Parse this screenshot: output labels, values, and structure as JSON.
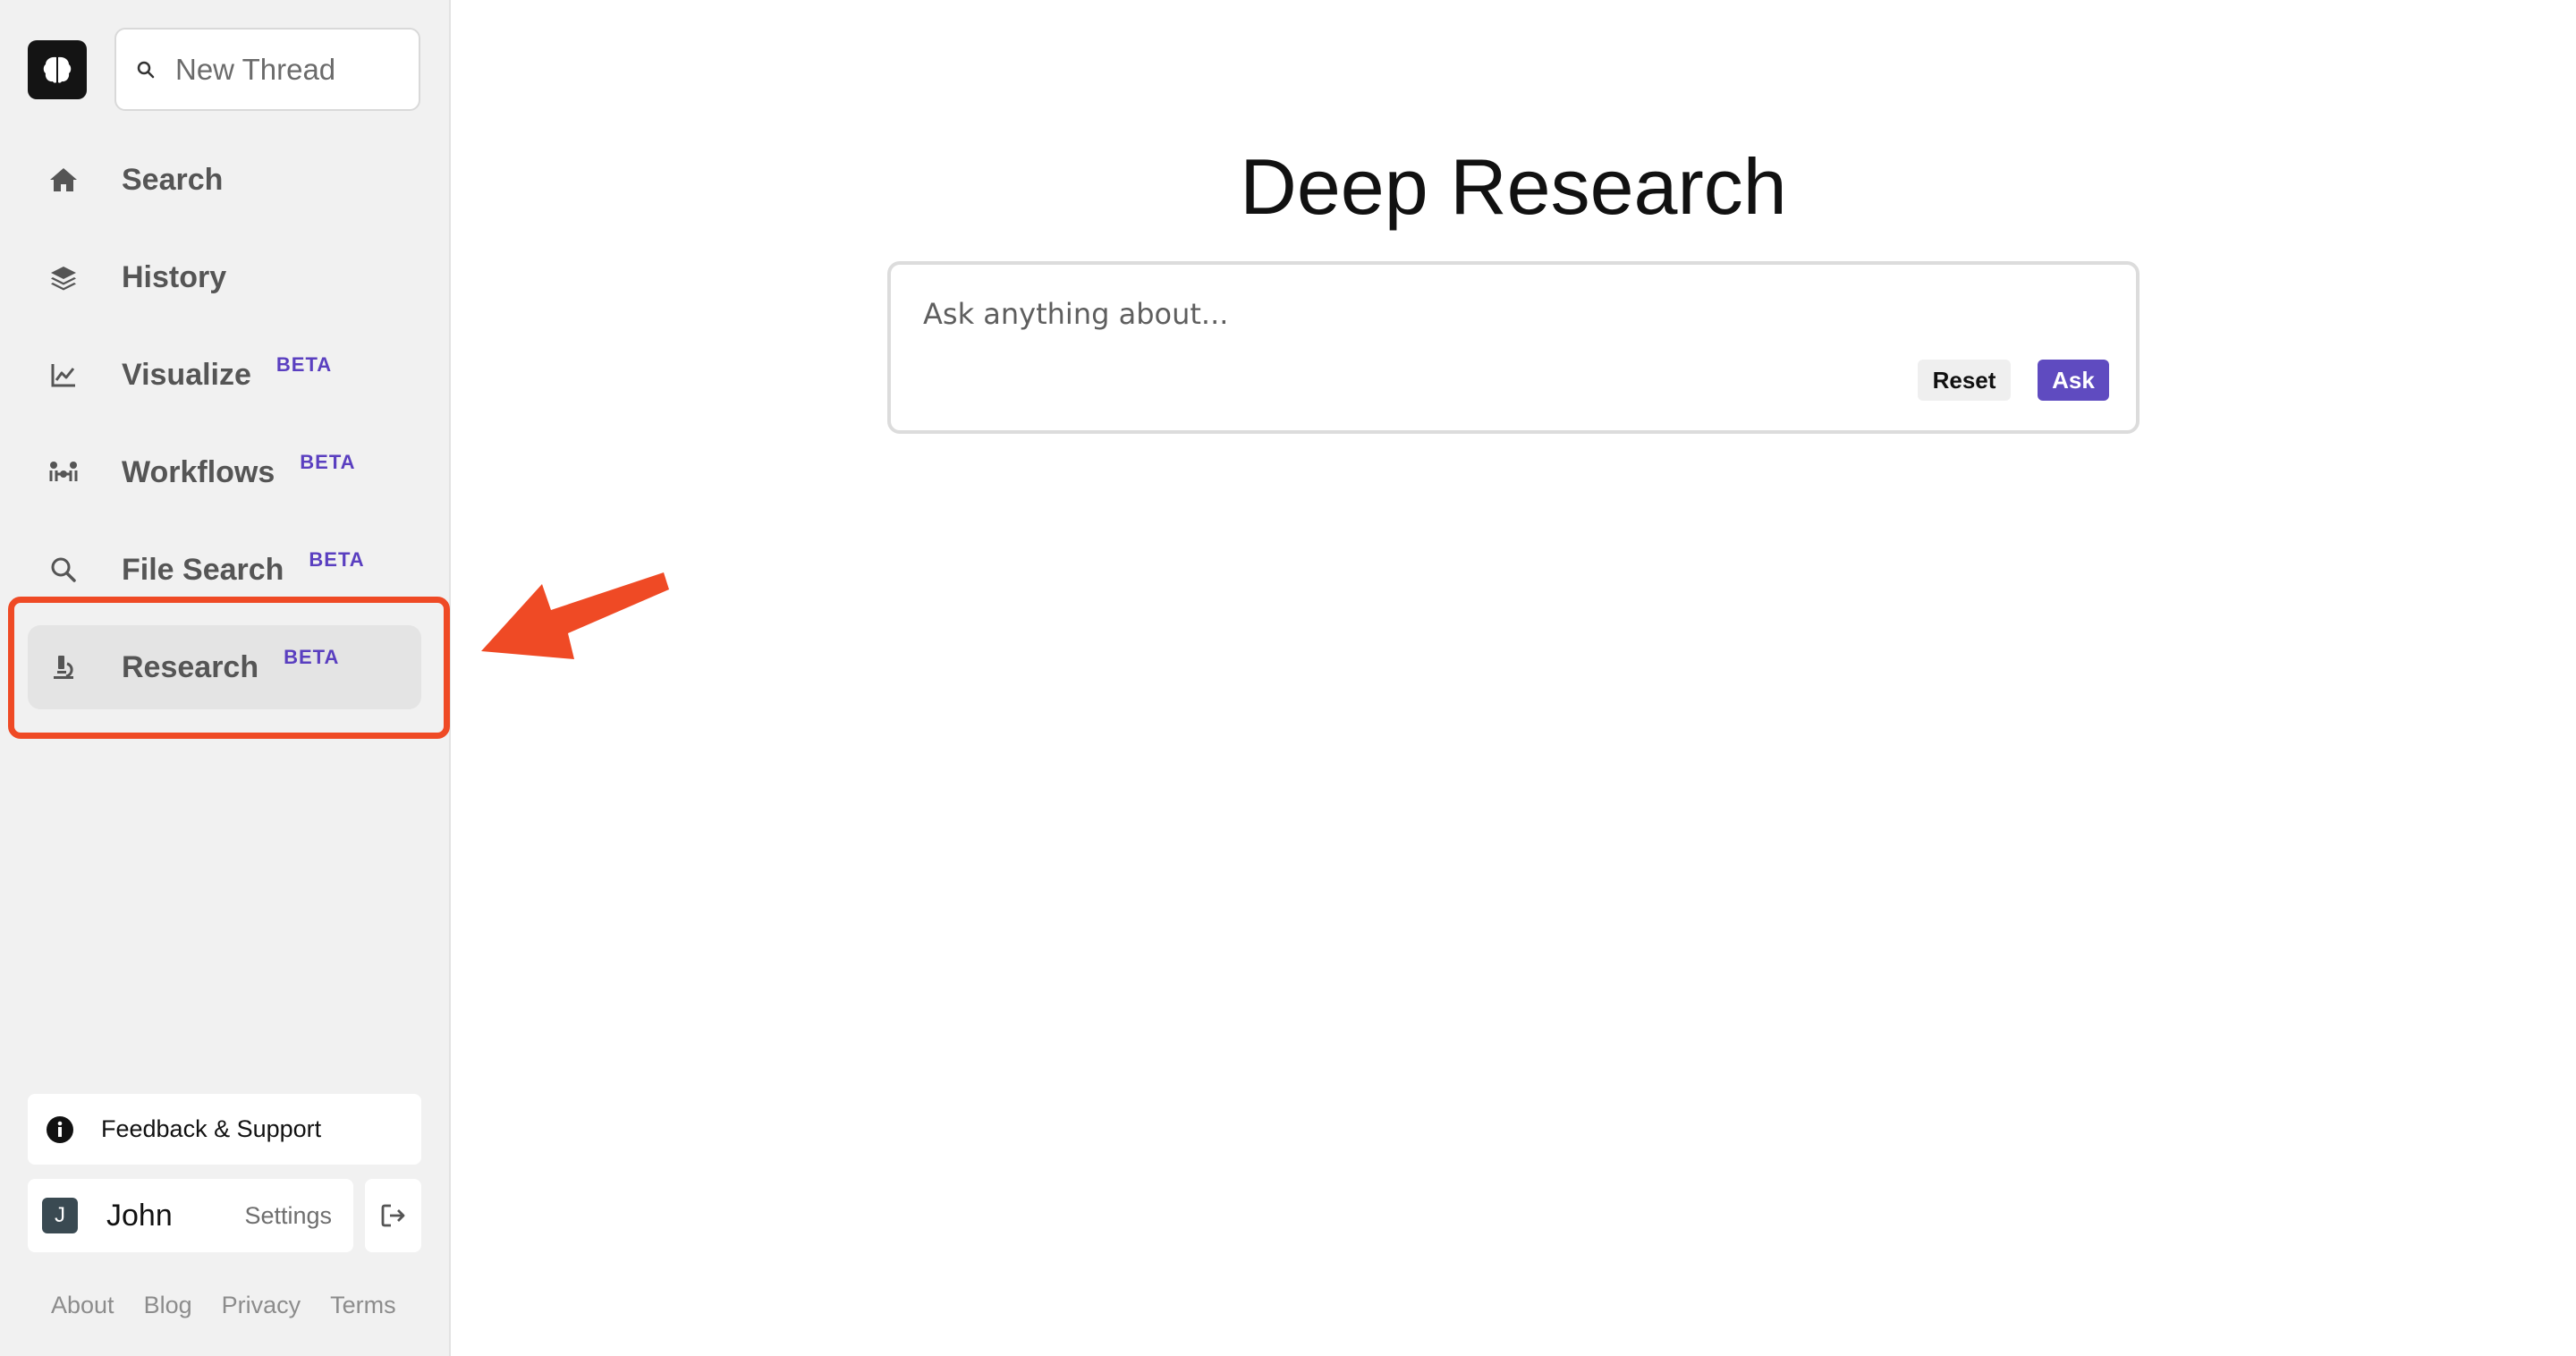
{
  "sidebar": {
    "new_thread_label": "New Thread",
    "items": [
      {
        "label": "Search",
        "icon": "home-icon",
        "beta": ""
      },
      {
        "label": "History",
        "icon": "layers-icon",
        "beta": ""
      },
      {
        "label": "Visualize",
        "icon": "line-chart-icon",
        "beta": "BETA"
      },
      {
        "label": "Workflows",
        "icon": "workflow-icon",
        "beta": "BETA"
      },
      {
        "label": "File Search",
        "icon": "magnifier-icon",
        "beta": "BETA"
      },
      {
        "label": "Research",
        "icon": "microscope-icon",
        "beta": "BETA"
      }
    ],
    "active_item": "Research",
    "feedback_label": "Feedback & Support",
    "user": {
      "initial": "J",
      "name": "John",
      "settings_label": "Settings"
    },
    "footer_links": [
      "About",
      "Blog",
      "Privacy",
      "Terms"
    ]
  },
  "main": {
    "title": "Deep Research",
    "ask_placeholder": "Ask anything about...",
    "reset_label": "Reset",
    "ask_label": "Ask"
  },
  "colors": {
    "accent": "#5f4bc0",
    "highlight": "#ef4a25",
    "sidebar_bg": "#f1f1f1"
  }
}
